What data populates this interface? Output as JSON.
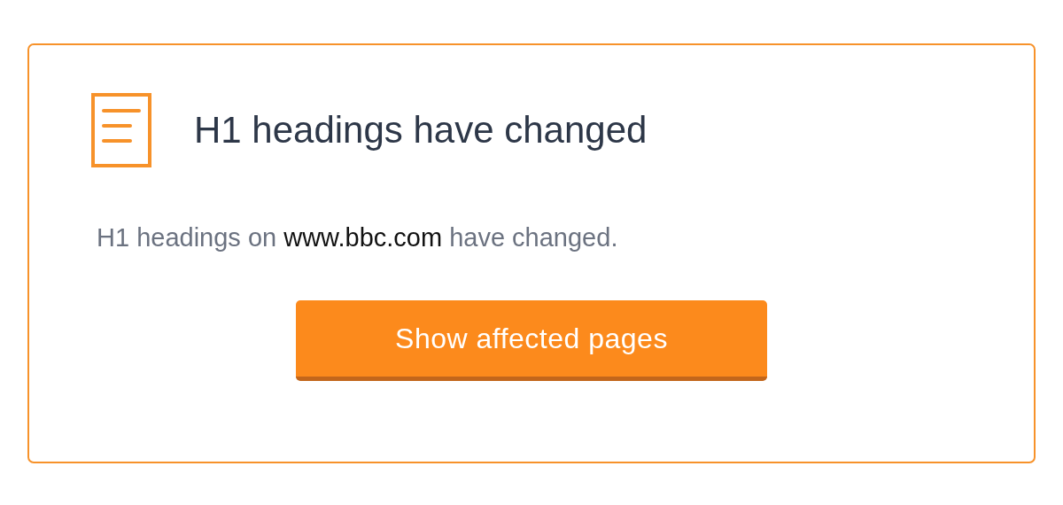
{
  "card": {
    "title": "H1 headings have changed",
    "description": {
      "before": "H1 headings on ",
      "link": "www.bbc.com",
      "after": " have changed."
    },
    "button": "Show affected pages"
  }
}
